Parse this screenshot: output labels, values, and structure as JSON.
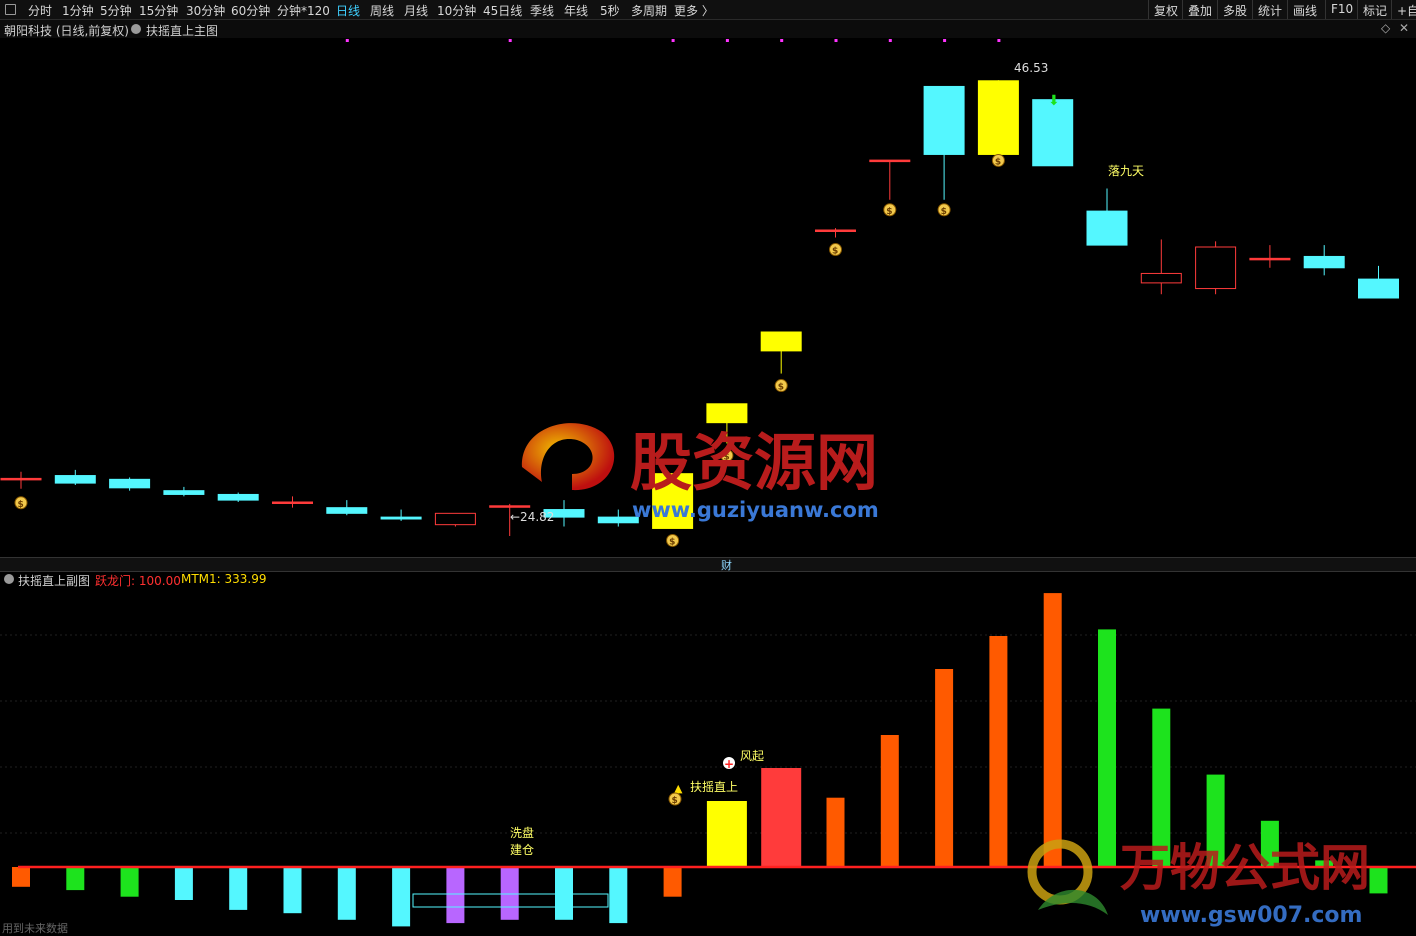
{
  "toolbar": {
    "items": [
      "分时",
      "1分钟",
      "5分钟",
      "15分钟",
      "30分钟",
      "60分钟",
      "分钟*120",
      "日线",
      "周线",
      "月线",
      "10分钟",
      "45日线",
      "季线",
      "年线",
      "5秒",
      "多周期",
      "更多 〉"
    ],
    "active": "日线",
    "right_items": [
      "复权",
      "叠加",
      "多股",
      "统计",
      "画线",
      "F10",
      "标记",
      "+自"
    ]
  },
  "main_chart": {
    "stock_title": "朝阳科技 (日线,前复权)",
    "indicator_name": "扶摇直上主图",
    "low_label": "←24.82",
    "high_label": "46.53",
    "annotation_fall": "落九天"
  },
  "divider_label": "财",
  "sub_chart": {
    "indicator_name": "扶摇直上副图",
    "label1": "跃龙门: 100.00",
    "label2": "MTM1: 333.99",
    "ann_wash": "洗盘",
    "ann_build": "建仓",
    "ann_rise": "扶摇直上",
    "ann_wind": "风起"
  },
  "watermark_main": {
    "cn": "股资源网",
    "url": "www.guziyuanw.com"
  },
  "watermark_sub": {
    "cn": "万物公式网",
    "url": "www.gsw007.com"
  },
  "bottom_note": "用到未来数据",
  "colors": {
    "up": "#ff3b3b",
    "down": "#54f7ff",
    "yellow": "#ffff00",
    "orange": "#ff5a00",
    "green": "#1de31d",
    "purple": "#b866ff"
  },
  "chart_data": {
    "type": "candlestick",
    "candles": [
      {
        "o": 25.4,
        "h": 25.8,
        "l": 24.9,
        "c": 25.45,
        "kind": "up"
      },
      {
        "o": 25.6,
        "h": 25.9,
        "l": 25.1,
        "c": 25.2,
        "kind": "down"
      },
      {
        "o": 25.4,
        "h": 25.5,
        "l": 24.8,
        "c": 24.95,
        "kind": "down"
      },
      {
        "o": 24.8,
        "h": 25.0,
        "l": 24.5,
        "c": 24.6,
        "kind": "down"
      },
      {
        "o": 24.6,
        "h": 24.7,
        "l": 24.2,
        "c": 24.3,
        "kind": "down"
      },
      {
        "o": 24.2,
        "h": 24.5,
        "l": 23.9,
        "c": 24.2,
        "kind": "up"
      },
      {
        "o": 23.9,
        "h": 24.3,
        "l": 23.5,
        "c": 23.6,
        "kind": "down"
      },
      {
        "o": 23.4,
        "h": 23.8,
        "l": 23.2,
        "c": 23.3,
        "kind": "down"
      },
      {
        "o": 23.0,
        "h": 23.6,
        "l": 22.9,
        "c": 23.6,
        "kind": "up_hollow"
      },
      {
        "o": 24.0,
        "h": 24.1,
        "l": 22.4,
        "c": 24.0,
        "kind": "up"
      },
      {
        "o": 23.8,
        "h": 24.3,
        "l": 22.9,
        "c": 23.4,
        "kind": "down"
      },
      {
        "o": 23.4,
        "h": 23.8,
        "l": 22.9,
        "c": 23.1,
        "kind": "down"
      },
      {
        "o": 22.8,
        "h": 25.7,
        "l": 22.8,
        "c": 25.7,
        "kind": "yellow"
      },
      {
        "o": 28.4,
        "h": 28.4,
        "l": 27.3,
        "c": 29.4,
        "kind": "yellow"
      },
      {
        "o": 32.2,
        "h": 32.2,
        "l": 31.0,
        "c": 33.2,
        "kind": "yellow"
      },
      {
        "o": 38.6,
        "h": 38.7,
        "l": 38.2,
        "c": 38.6,
        "kind": "up"
      },
      {
        "o": 42.3,
        "h": 42.3,
        "l": 40.2,
        "c": 42.3,
        "kind": "up"
      },
      {
        "o": 46.2,
        "h": 46.2,
        "l": 40.2,
        "c": 42.6,
        "kind": "down"
      },
      {
        "o": 42.6,
        "h": 46.53,
        "l": 42.6,
        "c": 46.5,
        "kind": "yellow"
      },
      {
        "o": 45.5,
        "h": 45.5,
        "l": 42.0,
        "c": 42.0,
        "kind": "down"
      },
      {
        "o": 39.6,
        "h": 40.8,
        "l": 37.8,
        "c": 37.8,
        "kind": "down"
      },
      {
        "o": 35.8,
        "h": 38.1,
        "l": 35.2,
        "c": 36.3,
        "kind": "up_hollow"
      },
      {
        "o": 35.5,
        "h": 38.0,
        "l": 35.2,
        "c": 37.7,
        "kind": "up_hollow"
      },
      {
        "o": 37.1,
        "h": 37.8,
        "l": 36.6,
        "c": 37.1,
        "kind": "up"
      },
      {
        "o": 37.2,
        "h": 37.8,
        "l": 36.2,
        "c": 36.6,
        "kind": "down"
      },
      {
        "o": 36.0,
        "h": 36.7,
        "l": 35.0,
        "c": 35.0,
        "kind": "down"
      }
    ],
    "y_range": [
      21.5,
      48.5
    ],
    "sub_bars": [
      {
        "v": -6,
        "c": "orange"
      },
      {
        "v": -7,
        "c": "green"
      },
      {
        "v": -9,
        "c": "green"
      },
      {
        "v": -10,
        "c": "down"
      },
      {
        "v": -13,
        "c": "down"
      },
      {
        "v": -14,
        "c": "down"
      },
      {
        "v": -16,
        "c": "down"
      },
      {
        "v": -18,
        "c": "down"
      },
      {
        "v": -17,
        "c": "purple"
      },
      {
        "v": -16,
        "c": "purple"
      },
      {
        "v": -16,
        "c": "down"
      },
      {
        "v": -17,
        "c": "down"
      },
      {
        "v": -9,
        "c": "orange"
      },
      {
        "v": 20,
        "c": "yellow"
      },
      {
        "v": 30,
        "c": "up"
      },
      {
        "v": 21,
        "c": "orange"
      },
      {
        "v": 40,
        "c": "orange"
      },
      {
        "v": 60,
        "c": "orange"
      },
      {
        "v": 70,
        "c": "orange"
      },
      {
        "v": 83,
        "c": "orange"
      },
      {
        "v": 72,
        "c": "green"
      },
      {
        "v": 48,
        "c": "green"
      },
      {
        "v": 28,
        "c": "green"
      },
      {
        "v": 14,
        "c": "green"
      },
      {
        "v": 2,
        "c": "green"
      },
      {
        "v": -8,
        "c": "green"
      },
      {
        "v": -19,
        "c": "down"
      }
    ]
  }
}
